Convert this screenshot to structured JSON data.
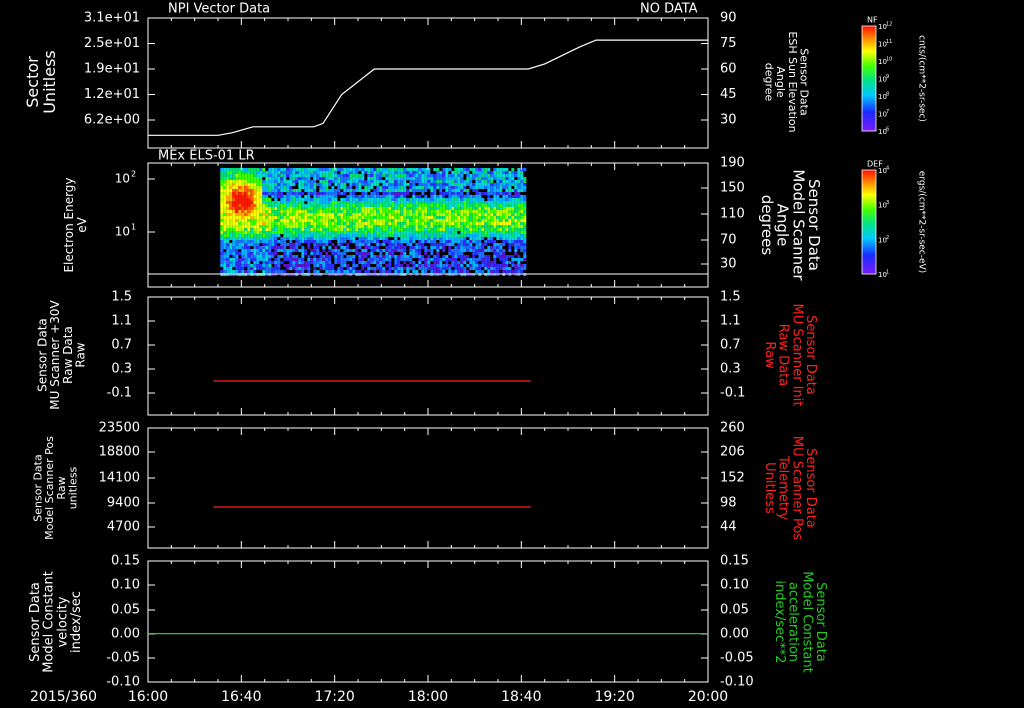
{
  "time_axis": {
    "date_label": "2015/360",
    "ticks": [
      "16:00",
      "16:40",
      "17:20",
      "18:00",
      "18:40",
      "19:20",
      "20:00"
    ]
  },
  "colors": {
    "axis": "#ffffff",
    "red_trace": "#ff2020",
    "green_trace": "#22cc22"
  },
  "chart_data": [
    {
      "type": "line",
      "title": "NPI Vector Data",
      "annotation": "NO DATA",
      "ylabel_left": [
        "Sector",
        "Unitless"
      ],
      "ylabel_right": [
        "Sensor Data",
        "ESH Sun Elevation",
        "Angle",
        "degree"
      ],
      "left_ticks": [
        "3.1e+01",
        "2.5e+01",
        "1.9e+01",
        "1.2e+01",
        "6.2e+00"
      ],
      "right_ticks": [
        "90",
        "75",
        "60",
        "45",
        "30"
      ],
      "right_ylim": [
        18,
        90
      ],
      "series": [
        {
          "x": [
            "16:00",
            "16:30",
            "16:36",
            "16:45",
            "17:11",
            "17:15",
            "17:23",
            "17:37",
            "18:43",
            "18:50",
            "19:05",
            "19:12",
            "20:00"
          ],
          "values": [
            21,
            21,
            22.5,
            26,
            26,
            28,
            45,
            60,
            60,
            63,
            73,
            77,
            77
          ]
        }
      ]
    },
    {
      "type": "heatmap",
      "title": "MEx ELS-01 LR",
      "ylabel_left": [
        "Electron Energy",
        "eV"
      ],
      "ylabel_right": [
        "Sensor Data",
        "Model Scanner",
        "Angle",
        "degrees"
      ],
      "left_ticks": [
        "10^2",
        "10^1"
      ],
      "right_ticks": [
        "190",
        "150",
        "110",
        "70",
        "30"
      ],
      "data_start": "16:31",
      "data_end": "18:41",
      "colorbar": {
        "label": "DEF",
        "units": "ergs/(cm**2-sr-sec-eV)",
        "ticks": [
          "10^4",
          "10^3",
          "10^2",
          "10^1"
        ]
      }
    },
    {
      "type": "line",
      "ylabel_left": [
        "Sensor Data",
        "MU Scanner +30V",
        "Raw Data",
        "Raw"
      ],
      "ylabel_right": [
        "Sensor Data",
        "MU Scanner Init",
        "Raw Data",
        "Raw"
      ],
      "left_ticks": [
        "1.5",
        "1.1",
        "0.7",
        "0.3",
        "-0.1"
      ],
      "right_ticks": [
        "1.5",
        "1.1",
        "0.7",
        "0.3",
        "-0.1"
      ],
      "ylim": [
        -0.4,
        1.5
      ],
      "series": [
        {
          "x": [
            "16:28",
            "18:44"
          ],
          "values": [
            0,
            0
          ]
        }
      ]
    },
    {
      "type": "line",
      "ylabel_left": [
        "Sensor Data",
        "Model Scanner Pos",
        "Raw",
        "unitless"
      ],
      "ylabel_right": [
        "Sensor Data",
        "MU Scanner Pos",
        "Telemetry",
        "Unitless"
      ],
      "left_ticks": [
        "23500",
        "18800",
        "14100",
        "9400",
        "4700"
      ],
      "right_ticks": [
        "260",
        "206",
        "152",
        "98",
        "44"
      ],
      "ylim": [
        0,
        23500
      ],
      "series": [
        {
          "x": [
            "16:28",
            "18:44"
          ],
          "values": [
            8500,
            8500
          ]
        }
      ]
    },
    {
      "type": "line",
      "ylabel_left": [
        "Sensor Data",
        "Model Constant",
        "velocity",
        "index/sec"
      ],
      "ylabel_right": [
        "Sensor Data",
        "Model Constant",
        "acceleration",
        "index/sec**2"
      ],
      "left_ticks": [
        "0.15",
        "0.10",
        "0.05",
        "0.00",
        "-0.05",
        "-0.10"
      ],
      "right_ticks": [
        "0.15",
        "0.10",
        "0.05",
        "0.00",
        "-0.05",
        "-0.10"
      ],
      "ylim": [
        -0.1,
        0.15
      ],
      "series": [
        {
          "x": [
            "16:00",
            "20:00"
          ],
          "values": [
            0,
            0
          ]
        }
      ]
    }
  ],
  "colorbar_top": {
    "label": "NF",
    "units": "cnts/(cm**2-sr-sec)",
    "ticks": [
      "10^12",
      "10^11",
      "10^10",
      "10^9",
      "10^8",
      "10^7",
      "10^6"
    ]
  }
}
